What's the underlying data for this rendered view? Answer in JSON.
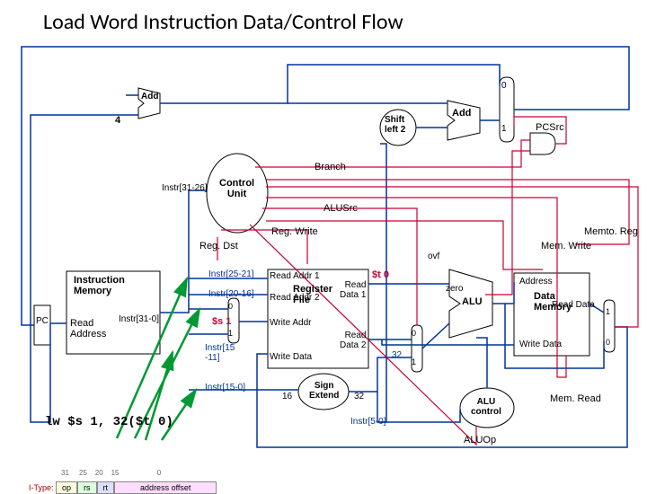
{
  "title": "Load Word Instruction Data/Control Flow",
  "blocks": {
    "pc": "PC",
    "imem": {
      "name": "Instruction\nMemory",
      "port1": "Read\nAddress",
      "out": "Instr[31-0]"
    },
    "add4": "Add",
    "const4": "4",
    "shiftleft": "Shift\nleft 2",
    "addbranch": "Add",
    "mux_pcsrc": {
      "in0": "0",
      "in1": "1",
      "label": "PCSrc"
    },
    "control": {
      "name": "Control\nUnit",
      "in": "Instr[31-26]"
    },
    "signals": {
      "branch": "Branch",
      "alusrc": "ALUSrc",
      "regwrite": "Reg. Write",
      "regdst": "Reg. Dst",
      "memtoreg": "Memto. Reg",
      "memwrite": "Mem. Write",
      "memread": "Mem. Read",
      "aluop": "ALUOp"
    },
    "regfile": {
      "name": "Register\nFile",
      "ra1": "Read Addr 1",
      "ra2": "Read Addr 2",
      "wa": "Write Addr",
      "wd": "Write Data",
      "rd1": "Read\nData 1",
      "rd2": "Read\nData 2"
    },
    "instr_fields": {
      "f2521": "Instr[25-21]",
      "f2016": "Instr[20-16]",
      "f1511": "Instr[15\n-11]",
      "f150": "Instr[15-0]",
      "f50": "Instr[5-0]"
    },
    "mux_regdst": {
      "in0": "0",
      "in1": "1"
    },
    "mux_alusrc": {
      "in0": "0",
      "in1": "1"
    },
    "mux_memtoreg": {
      "in0": "0",
      "in1": "1"
    },
    "signext": {
      "name": "Sign\nExtend",
      "in": "16",
      "out": "32"
    },
    "alu": {
      "name": "ALU",
      "ovf": "ovf",
      "zero": "zero"
    },
    "alucontrol": "ALU\ncontrol",
    "dmem": {
      "name": "Data\nMemory",
      "addr": "Address",
      "wd": "Write Data",
      "rd": "Read Data"
    },
    "constbarrel": "32",
    "rf_in1": "$t 0",
    "rf_in2": "$s 1"
  },
  "instruction": "lw $s 1, 32($t 0)",
  "footer_fields": [
    "I-Type:",
    "31",
    "25",
    "20",
    "15",
    "0",
    "op",
    "rs",
    "rt",
    "address offset"
  ]
}
